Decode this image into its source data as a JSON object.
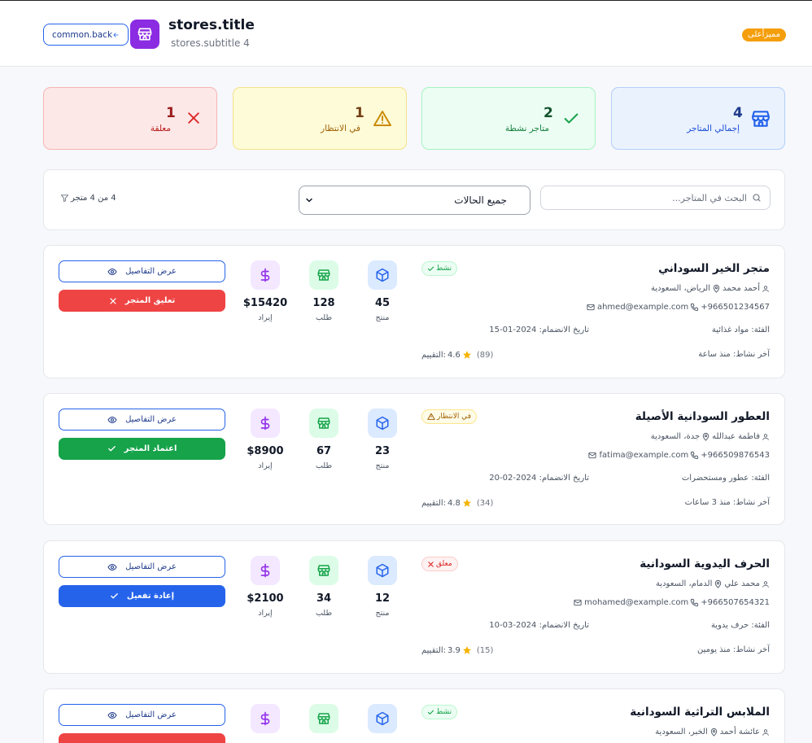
{
  "header": {
    "back_label": "common.back",
    "title": "stores.title",
    "subtitle": "stores.subtitle 4",
    "role_badge": "مميزأعلى"
  },
  "stats": [
    {
      "value": "4",
      "label": "إجمالي المتاجر",
      "icon": "store-icon",
      "color": "#2563eb"
    },
    {
      "value": "2",
      "label": "متاجر نشطة",
      "icon": "check-icon",
      "color": "#16a34a"
    },
    {
      "value": "1",
      "label": "في الانتظار",
      "icon": "warning-icon",
      "color": "#ca8a04"
    },
    {
      "value": "1",
      "label": "معلقة",
      "icon": "x-icon",
      "color": "#dc2626"
    }
  ],
  "filters": {
    "search_placeholder": "البحث في المتاجر...",
    "status_value": "جميع الحالات",
    "count_label": "4 من 4 متجر"
  },
  "stores": [
    {
      "name": "متجر الخير السوداني",
      "status": "نشط",
      "location": "الرياض، السعودية",
      "owner": "أحمد محمد",
      "phone": "+966501234567",
      "email": "ahmed@example.com",
      "category": "الفئة: مواد غذائية",
      "joined": "تاريخ الانضمام: 2024-01-15",
      "last_active": "آخر نشاط: منذ ساعة",
      "rating_label": "التقييم:",
      "rating": "4.6",
      "reviews": "(89)",
      "products": "45",
      "products_label": "منتج",
      "orders": "128",
      "orders_label": "طلب",
      "revenue": "$15420",
      "revenue_label": "إيراد",
      "details_label": "عرض التفاصيل",
      "action_label": "تعليق المتجر",
      "action_icon": "x-icon",
      "action_color": "#ef4444"
    },
    {
      "name": "العطور السودانية الأصيلة",
      "status": "في الانتظار",
      "location": "جدة، السعودية",
      "owner": "فاطمة عبدالله",
      "phone": "+966509876543",
      "email": "fatima@example.com",
      "category": "الفئة: عطور ومستحضرات",
      "joined": "تاريخ الانضمام: 2024-02-20",
      "last_active": "آخر نشاط: منذ 3 ساعات",
      "rating_label": "التقييم:",
      "rating": "4.8",
      "reviews": "(34)",
      "products": "23",
      "products_label": "منتج",
      "orders": "67",
      "orders_label": "طلب",
      "revenue": "$8900",
      "revenue_label": "إيراد",
      "details_label": "عرض التفاصيل",
      "action_label": "اعتماد المتجر",
      "action_icon": "check-icon",
      "action_color": "#16a34a"
    },
    {
      "name": "الحرف اليدوية السودانية",
      "status": "معلق",
      "location": "الدمام، السعودية",
      "owner": "محمد علي",
      "phone": "+966507654321",
      "email": "mohamed@example.com",
      "category": "الفئة: حرف يدوية",
      "joined": "تاريخ الانضمام: 2024-03-10",
      "last_active": "آخر نشاط: منذ يومين",
      "rating_label": "التقييم:",
      "rating": "3.9",
      "reviews": "(15)",
      "products": "12",
      "products_label": "منتج",
      "orders": "34",
      "orders_label": "طلب",
      "revenue": "$2100",
      "revenue_label": "إيراد",
      "details_label": "عرض التفاصيل",
      "action_label": "إعادة تفعيل",
      "action_icon": "check-icon",
      "action_color": "#2563eb"
    },
    {
      "name": "الملابس التراثية السودانية",
      "status": "نشط",
      "location": "الخبر، السعودية",
      "owner": "عائشة أحمد",
      "details_label": "عرض التفاصيل",
      "action_color": "#ef4444"
    }
  ]
}
